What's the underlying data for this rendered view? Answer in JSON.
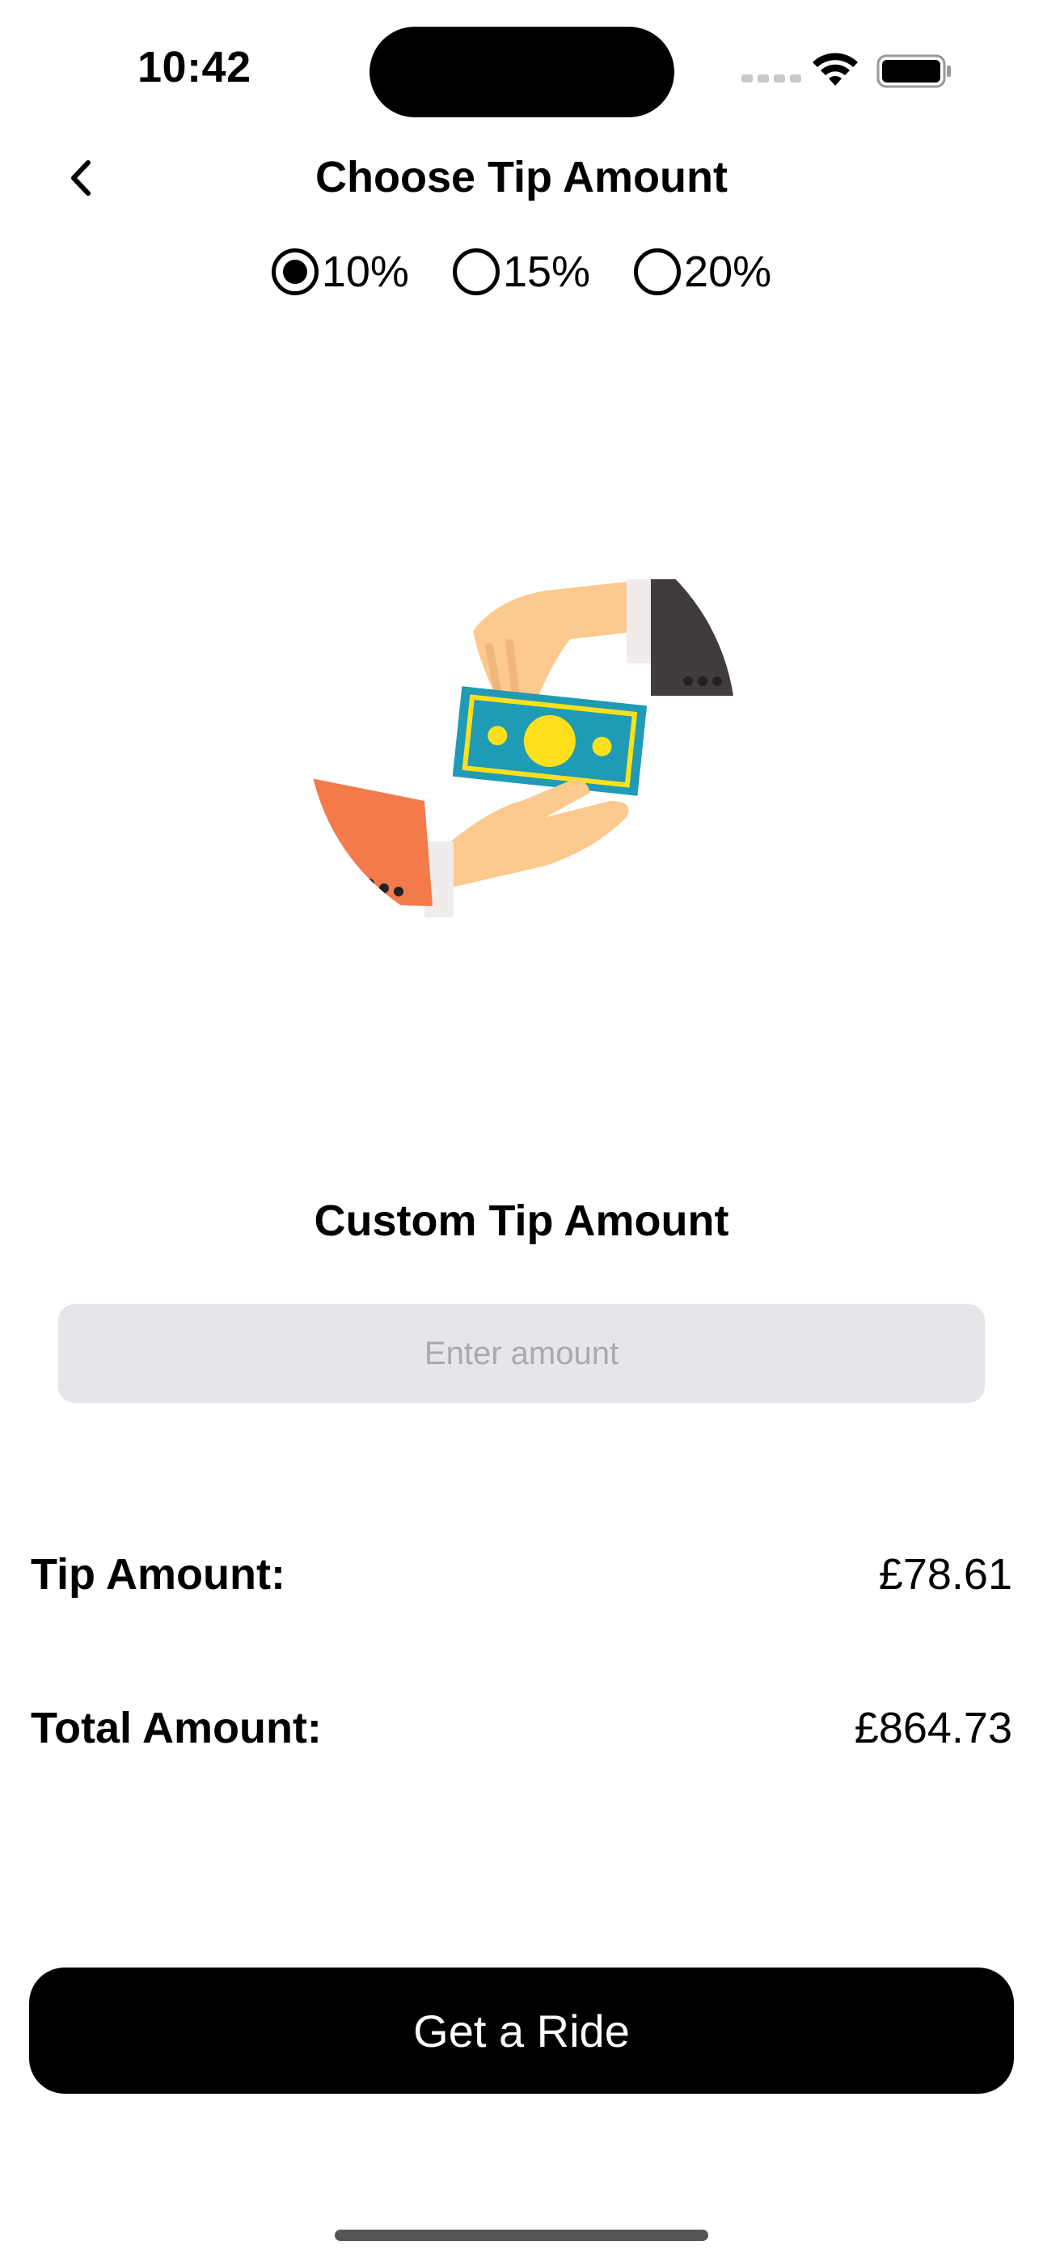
{
  "status_bar": {
    "time": "10:42"
  },
  "header": {
    "title": "Choose Tip Amount",
    "back_icon": "chevron-left-icon"
  },
  "tip_options": [
    {
      "label": "10%",
      "selected": true
    },
    {
      "label": "15%",
      "selected": false
    },
    {
      "label": "20%",
      "selected": false
    }
  ],
  "illustration": {
    "icon": "hands-exchanging-money-illustration",
    "colors": {
      "note": "#1f9bb5",
      "coin": "#ffe01b",
      "skin": "#fcc98e",
      "left_sleeve": "#f37a4a",
      "right_sleeve": "#3f3c3b"
    }
  },
  "custom_tip": {
    "title": "Custom Tip Amount",
    "placeholder": "Enter amount",
    "value": ""
  },
  "summary": {
    "tip_label": "Tip Amount:",
    "tip_value": "£78.61",
    "total_label": "Total Amount:",
    "total_value": "£864.73"
  },
  "cta": {
    "label": "Get a Ride",
    "color": "#000000"
  }
}
